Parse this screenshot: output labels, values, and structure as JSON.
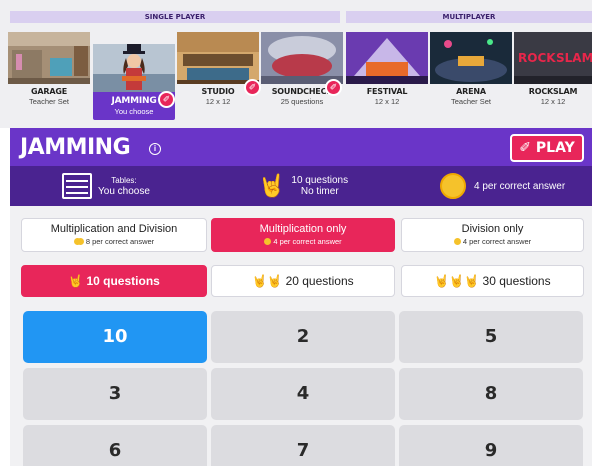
{
  "sections": {
    "single_player": "SINGLE PLAYER",
    "multiplayer": "MULTIPLAYER"
  },
  "modes": [
    {
      "name": "GARAGE",
      "sub": "Teacher Set"
    },
    {
      "name": "JAMMING",
      "sub": "You choose"
    },
    {
      "name": "STUDIO",
      "sub": "12 x 12"
    },
    {
      "name": "SOUNDCHECK",
      "sub": "25 questions"
    },
    {
      "name": "FESTIVAL",
      "sub": "12 x 12"
    },
    {
      "name": "ARENA",
      "sub": "Teacher Set"
    },
    {
      "name": "ROCKSLAM",
      "sub": "12 x 12"
    }
  ],
  "title": "JAMMING",
  "info_icon": "i",
  "play_label": "PLAY",
  "info": {
    "tables_label": "Tables:",
    "tables_value": "You choose",
    "questions_line1": "10 questions",
    "questions_line2": "No timer",
    "coins": "4 per correct answer"
  },
  "options": [
    {
      "label": "Multiplication and Division",
      "reward": "8 per correct answer"
    },
    {
      "label": "Multiplication only",
      "reward": "4 per correct answer"
    },
    {
      "label": "Division only",
      "reward": "4 per correct answer"
    }
  ],
  "question_counts": [
    "10 questions",
    "20 questions",
    "30 questions"
  ],
  "numbers": [
    "10",
    "2",
    "5",
    "3",
    "4",
    "8",
    "6",
    "7",
    "9"
  ],
  "colors": {
    "purple": "#6a35c8",
    "dark_purple": "#4a2390",
    "pink": "#e8265a",
    "blue": "#2196f3",
    "gold": "#f5c22b"
  },
  "icons": [
    "guitar-icon",
    "info-icon",
    "abacus-icon",
    "rocker-icon",
    "coin-icon"
  ]
}
